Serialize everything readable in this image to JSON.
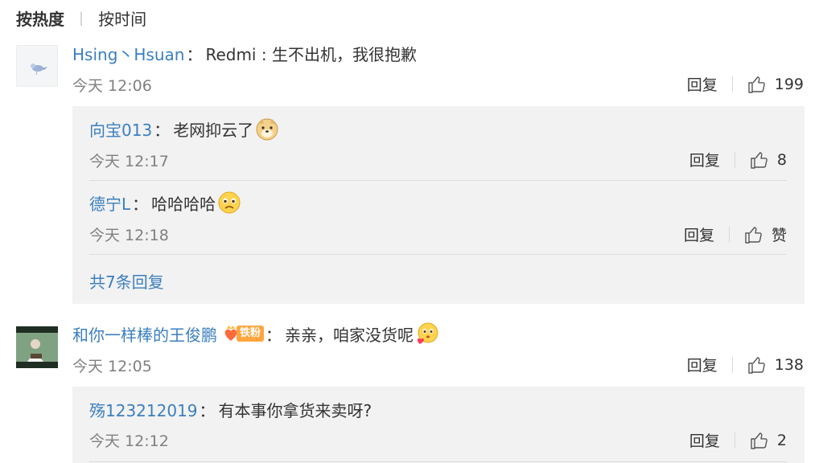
{
  "sort": {
    "hot_label": "按热度",
    "separator": "|",
    "time_label": "按时间"
  },
  "comments": [
    {
      "user": "Hsing丶Hsuan",
      "colon": "：",
      "text": "Redmi : 生不出机，我很抱歉",
      "time": "今天 12:06",
      "reply_label": "回复",
      "likes": "199",
      "replies": [
        {
          "user": "向宝013",
          "colon": "：",
          "text": "老网抑云了",
          "emoji": "doge-emoji",
          "time": "今天 12:17",
          "reply_label": "回复",
          "likes": "8"
        },
        {
          "user": "德宁L",
          "colon": "：",
          "text": "哈哈哈哈",
          "emoji": "sad-emoji",
          "time": "今天 12:18",
          "reply_label": "回复",
          "likes": "赞"
        }
      ],
      "more_replies": "共7条回复"
    },
    {
      "user": "和你一样棒的王俊鹏",
      "badge": "铁粉",
      "colon": "：",
      "text": "亲亲，咱家没货呢",
      "emoji": "heart-kiss-emoji",
      "time": "今天 12:05",
      "reply_label": "回复",
      "likes": "138",
      "replies": [
        {
          "user": "殇123212019",
          "colon": "：",
          "text": "有本事你拿货来卖呀?",
          "time": "今天 12:12",
          "reply_label": "回复",
          "likes": "2"
        }
      ]
    }
  ],
  "colors": {
    "link": "#3b7fbf",
    "reply_bg": "#f2f2f2",
    "muted": "#808080"
  },
  "icons": {
    "like": "thumbs-up-icon"
  }
}
